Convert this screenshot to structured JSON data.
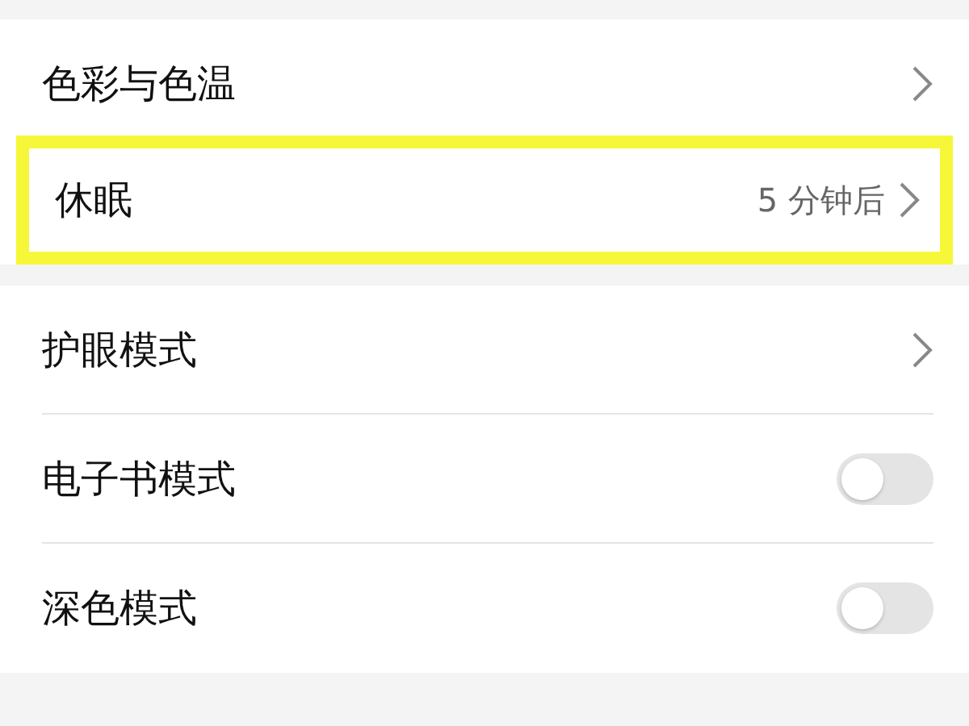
{
  "groups": [
    {
      "rows": [
        {
          "kind": "link",
          "label": "色彩与色温",
          "highlighted": false
        },
        {
          "kind": "link",
          "label": "休眠",
          "value": "5 分钟后",
          "highlighted": true
        }
      ]
    },
    {
      "rows": [
        {
          "kind": "link",
          "label": "护眼模式",
          "highlighted": false
        },
        {
          "kind": "toggle",
          "label": "电子书模式",
          "on": false,
          "highlighted": false
        },
        {
          "kind": "toggle",
          "label": "深色模式",
          "on": false,
          "highlighted": false
        }
      ]
    }
  ]
}
